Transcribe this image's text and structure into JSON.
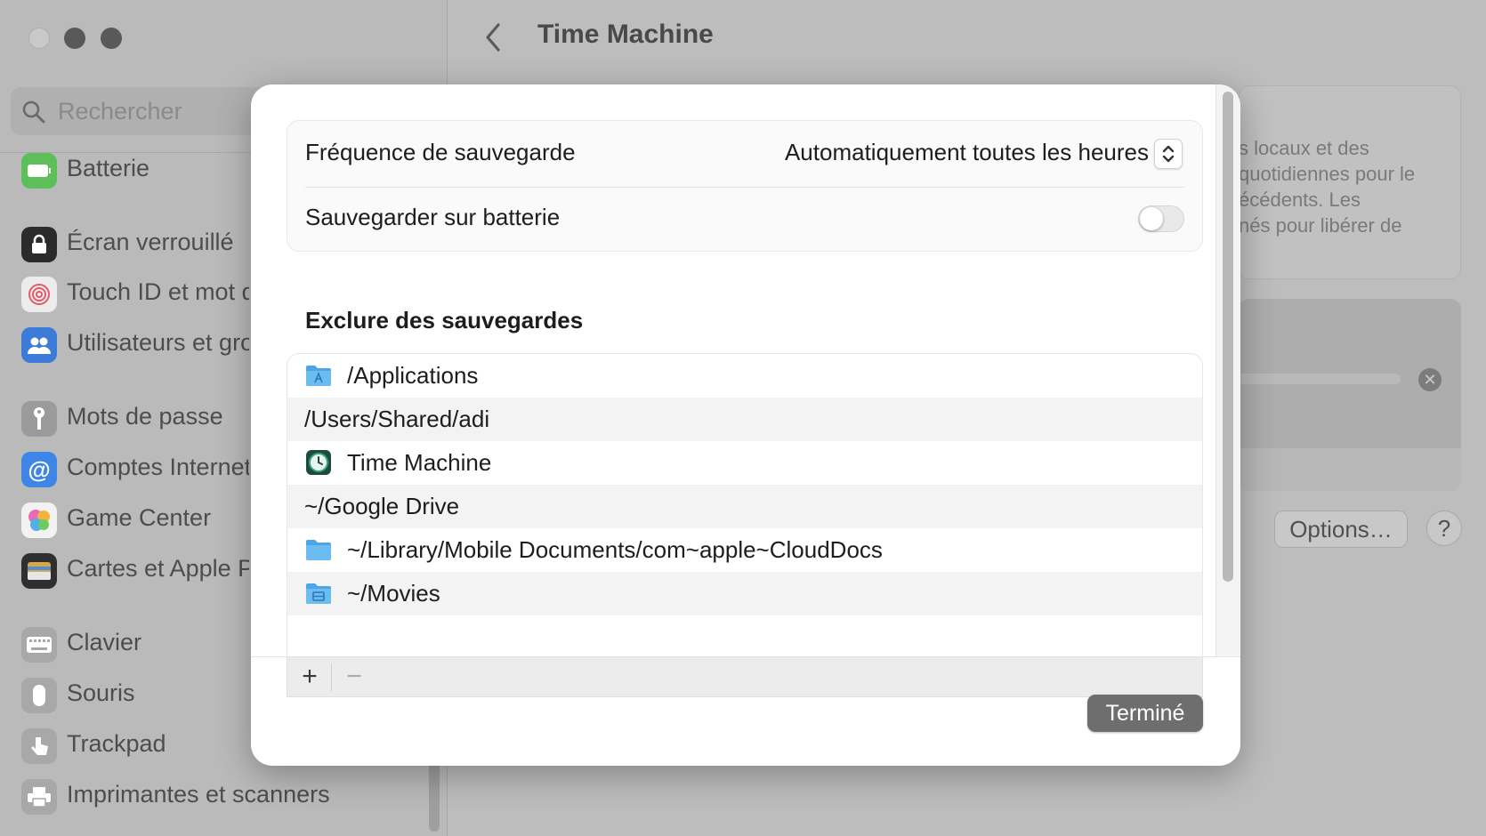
{
  "window": {
    "title": "Time Machine"
  },
  "search": {
    "placeholder": "Rechercher"
  },
  "sidebar": {
    "items": [
      {
        "label": "Batterie",
        "icon": "battery-icon",
        "color": "#5dbf5a"
      },
      {
        "label": "Écran verrouillé",
        "icon": "lock-icon",
        "color": "#2b2b2b"
      },
      {
        "label": "Touch ID et mot de passe",
        "icon": "fingerprint-icon",
        "color": "#e8e8e8"
      },
      {
        "label": "Utilisateurs et groupes",
        "icon": "users-icon",
        "color": "#3d7bd8"
      },
      {
        "label": "Mots de passe",
        "icon": "key-icon",
        "color": "#9b9b9b"
      },
      {
        "label": "Comptes Internet",
        "icon": "at-icon",
        "color": "#3d86e8"
      },
      {
        "label": "Game Center",
        "icon": "game-center-icon",
        "color": "#f2f2f2"
      },
      {
        "label": "Cartes et Apple Pay",
        "icon": "wallet-icon",
        "color": "#2f2f2f"
      },
      {
        "label": "Clavier",
        "icon": "keyboard-icon",
        "color": "#a8a8a8"
      },
      {
        "label": "Souris",
        "icon": "mouse-icon",
        "color": "#a8a8a8"
      },
      {
        "label": "Trackpad",
        "icon": "trackpad-icon",
        "color": "#a8a8a8"
      },
      {
        "label": "Imprimantes et scanners",
        "icon": "printer-icon",
        "color": "#a8a8a8"
      }
    ]
  },
  "background": {
    "info_lines": [
      "s locaux et des",
      "quotidiennes pour le",
      "écédents. Les",
      "nés pour libérer de"
    ],
    "options_label": "Options…",
    "help_label": "?"
  },
  "modal": {
    "frequency": {
      "label": "Fréquence de sauvegarde",
      "value": "Automatiquement toutes les heures"
    },
    "battery": {
      "label": "Sauvegarder sur batterie",
      "enabled": false
    },
    "exclude_title": "Exclure des sauvegardes",
    "excluded": [
      {
        "path": "/Applications",
        "icon": "applications-folder-icon"
      },
      {
        "path": "/Users/Shared/adi",
        "icon": ""
      },
      {
        "path": "Time Machine",
        "icon": "time-machine-icon"
      },
      {
        "path": "~/Google Drive",
        "icon": ""
      },
      {
        "path": "~/Library/Mobile Documents/com~apple~CloudDocs",
        "icon": "folder-icon"
      },
      {
        "path": "~/Movies",
        "icon": "movies-folder-icon"
      }
    ],
    "add_label": "+",
    "remove_label": "−",
    "done_label": "Terminé"
  },
  "colors": {
    "accent_folder": "#4aa6e6",
    "done_button": "#6e6e6e"
  }
}
